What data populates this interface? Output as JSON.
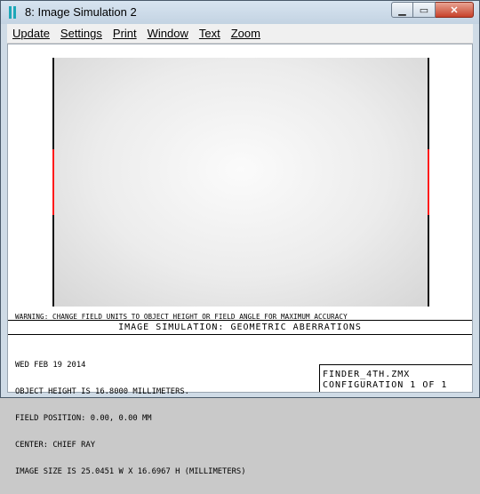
{
  "window": {
    "title": "8: Image Simulation 2",
    "controls": {
      "minimize_icon": "minimize-icon",
      "maximize_icon": "maximize-icon",
      "close_icon": "close-icon",
      "minimize_glyph": "▁",
      "maximize_glyph": "▭",
      "close_glyph": "✕"
    }
  },
  "menu": {
    "items": [
      "Update",
      "Settings",
      "Print",
      "Window",
      "Text",
      "Zoom"
    ]
  },
  "plot": {
    "warning": "WARNING: CHANGE FIELD UNITS TO OBJECT HEIGHT OR FIELD ANGLE FOR MAXIMUM ACCURACY",
    "caption": "IMAGE SIMULATION: GEOMETRIC ABERRATIONS",
    "info_lines": [
      "WED FEB 19 2014",
      "OBJECT HEIGHT IS 16.8000 MILLIMETERS.",
      "FIELD POSITION: 0.00, 0.00 MM",
      "CENTER: CHIEF RAY",
      "IMAGE SIZE IS 25.0451 W X 16.6967 H (MILLIMETERS)"
    ],
    "file_name": "FINDER_4TH.ZMX",
    "configuration": "CONFIGURATION 1 OF 1"
  },
  "colors": {
    "accent_marker": "#ff1a1a",
    "app_icon": "#1da7b8"
  }
}
